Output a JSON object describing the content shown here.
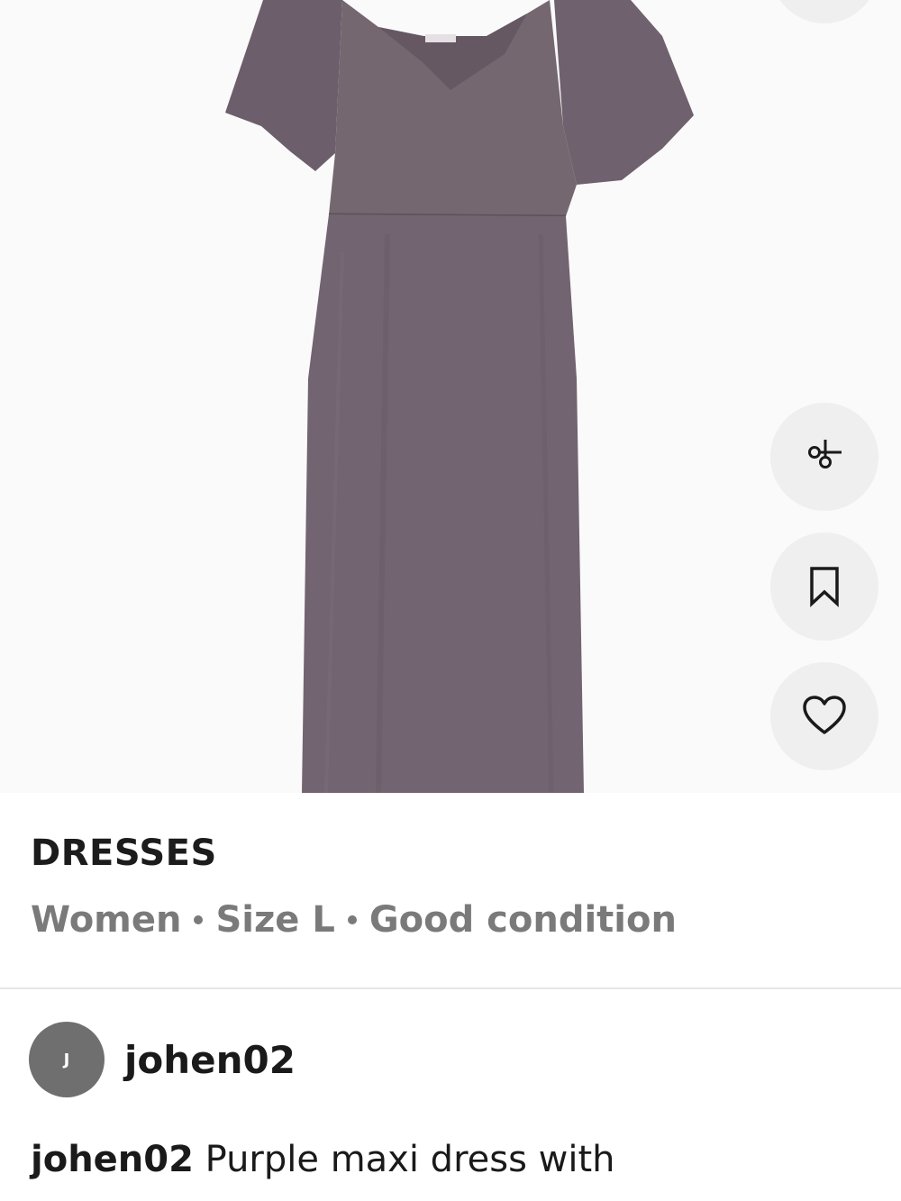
{
  "product": {
    "image_alt": "Purple maxi dress with flutter sleeves",
    "dress_color": "#726470",
    "background_color": "#f8f8f8"
  },
  "actions": [
    {
      "name": "share",
      "icon": "share-icon"
    },
    {
      "name": "save",
      "icon": "bookmark-icon"
    },
    {
      "name": "like",
      "icon": "heart-icon"
    }
  ],
  "info": {
    "category": "DRESSES",
    "gender": "Women",
    "size": "Size L",
    "condition": "Good condition"
  },
  "seller": {
    "initial": "J",
    "username": "johen02"
  },
  "description": {
    "username": "johen02",
    "text": "Purple maxi dress with"
  },
  "colors": {
    "button_bg": "#efefef",
    "avatar_bg": "#6f6f6f",
    "muted_text": "#7a7a7a",
    "divider": "#e6e6e6"
  }
}
